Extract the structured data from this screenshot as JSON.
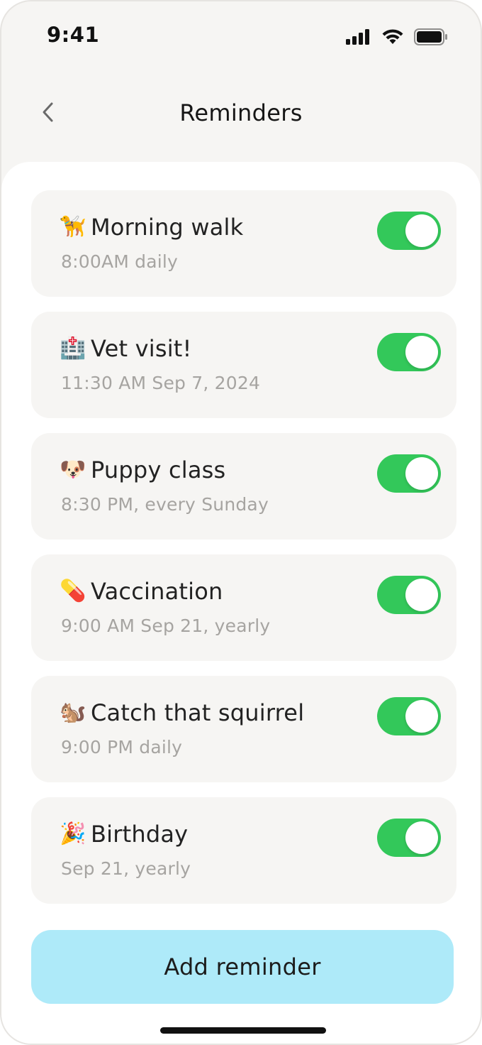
{
  "status_bar": {
    "time": "9:41",
    "icons": [
      "signal-icon",
      "wifi-icon",
      "battery-icon"
    ]
  },
  "header": {
    "title": "Reminders",
    "back_icon": "chevron-left-icon"
  },
  "reminders": [
    {
      "emoji": "🦮",
      "icon": "dog-icon",
      "title": "Morning walk",
      "subtitle": "8:00AM daily",
      "enabled": true
    },
    {
      "emoji": "🏥",
      "icon": "hospital-icon",
      "title": "Vet visit!",
      "subtitle": "11:30 AM Sep 7, 2024",
      "enabled": true
    },
    {
      "emoji": "🐶",
      "icon": "puppy-icon",
      "title": "Puppy class",
      "subtitle": "8:30 PM, every Sunday",
      "enabled": true
    },
    {
      "emoji": "💊",
      "icon": "pill-icon",
      "title": "Vaccination",
      "subtitle": "9:00 AM Sep 21, yearly",
      "enabled": true
    },
    {
      "emoji": "🐿️",
      "icon": "squirrel-icon",
      "title": "Catch that squirrel",
      "subtitle": "9:00 PM daily",
      "enabled": true
    },
    {
      "emoji": "🎉",
      "icon": "party-icon",
      "title": "Birthday",
      "subtitle": "Sep 21, yearly",
      "enabled": true
    }
  ],
  "add_button": {
    "label": "Add reminder"
  },
  "colors": {
    "background": "#f6f5f3",
    "card": "#f6f5f3",
    "toggle_on": "#33c85a",
    "button": "#aeeaf9",
    "subtitle_text": "#a6a4a1"
  }
}
